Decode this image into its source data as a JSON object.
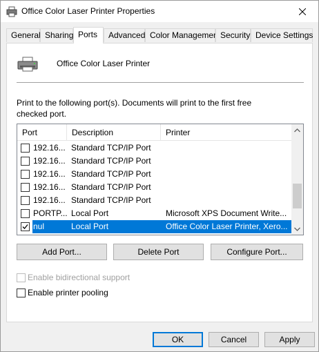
{
  "window": {
    "title": "Office Color Laser Printer Properties"
  },
  "tabs": [
    {
      "label": "General"
    },
    {
      "label": "Sharing"
    },
    {
      "label": "Ports"
    },
    {
      "label": "Advanced"
    },
    {
      "label": "Color Management"
    },
    {
      "label": "Security"
    },
    {
      "label": "Device Settings"
    }
  ],
  "active_tab": "Ports",
  "printer": {
    "name": "Office Color Laser Printer"
  },
  "instructions": "Print to the following port(s). Documents will print to the first free checked port.",
  "port_list": {
    "columns": [
      "Port",
      "Description",
      "Printer"
    ],
    "rows": [
      {
        "port": "192.16...",
        "description": "Standard TCP/IP Port",
        "printer": "",
        "checked": false
      },
      {
        "port": "192.16...",
        "description": "Standard TCP/IP Port",
        "printer": "",
        "checked": false
      },
      {
        "port": "192.16...",
        "description": "Standard TCP/IP Port",
        "printer": "",
        "checked": false
      },
      {
        "port": "192.16...",
        "description": "Standard TCP/IP Port",
        "printer": "",
        "checked": false
      },
      {
        "port": "192.16...",
        "description": "Standard TCP/IP Port",
        "printer": "",
        "checked": false
      },
      {
        "port": "PORTP...",
        "description": "Local Port",
        "printer": "Microsoft XPS Document Write...",
        "checked": false
      },
      {
        "port": "nul",
        "description": "Local Port",
        "printer": "Office Color Laser Printer, Xero...",
        "checked": true,
        "selected": true
      }
    ]
  },
  "port_buttons": {
    "add": "Add Port...",
    "delete": "Delete Port",
    "configure": "Configure Port..."
  },
  "options": {
    "bidirectional": {
      "label": "Enable bidirectional support",
      "checked": false,
      "enabled": false
    },
    "pooling": {
      "label": "Enable printer pooling",
      "checked": false,
      "enabled": true
    }
  },
  "footer": {
    "ok": "OK",
    "cancel": "Cancel",
    "apply": "Apply"
  },
  "colors": {
    "selection": "#0078d7",
    "window_bg": "#f0f0f0",
    "panel_bg": "#ffffff"
  }
}
